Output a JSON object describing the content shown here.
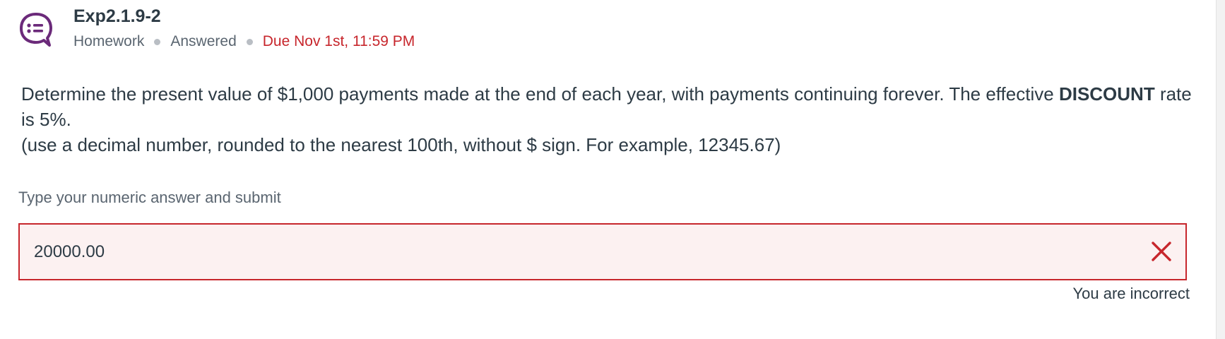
{
  "header": {
    "title": "Exp2.1.9-2",
    "type_icon": "discussion-list-icon",
    "meta": {
      "type": "Homework",
      "status": "Answered",
      "due": "Due Nov 1st, 11:59 PM"
    }
  },
  "question": {
    "text_part1": "Determine the present value of $1,000 payments made at the end of each year, with payments continuing forever. The effective ",
    "text_bold": "DISCOUNT",
    "text_part2": " rate is 5%.",
    "note": "(use a decimal number, rounded to the nearest 100th, without $ sign. For example, 12345.67)"
  },
  "answer": {
    "instruction": "Type your numeric answer and submit",
    "value": "20000.00",
    "result_icon": "close-x-icon",
    "feedback": "You are incorrect"
  },
  "colors": {
    "accent": "#6b2a7a",
    "error": "#c7262c",
    "error_bg": "#fcf1f1",
    "text": "#2d3b45",
    "muted": "#5a6570"
  }
}
